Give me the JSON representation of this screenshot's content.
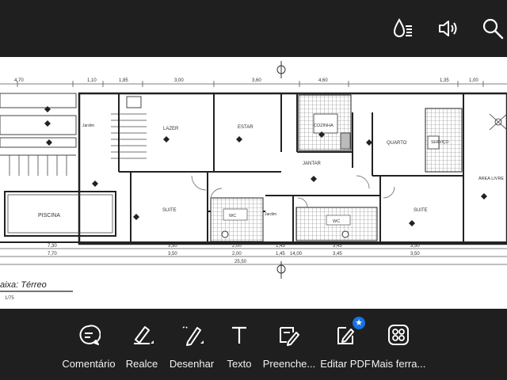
{
  "top_bar": {
    "icons": [
      "read-aloud-icon",
      "speaker-icon",
      "search-icon"
    ]
  },
  "document": {
    "dimensions_top": [
      "4,70",
      "1,10",
      "1,85",
      "3,00",
      "3,60",
      "4,60",
      "1,35",
      "1,00"
    ],
    "dimensions_bottom_1": [
      "7,30",
      "3,50",
      "2,00",
      "1,45",
      "3,45",
      "3,50"
    ],
    "dimensions_bottom_2": [
      "7,70",
      "3,50",
      "2,00",
      "1,45",
      "3,45",
      "3,50"
    ],
    "total_width": "25,50",
    "total_width_2": "14,00",
    "rooms": {
      "lazer": "LAZER",
      "estar": "ESTAR",
      "cozinha": "COZINHA",
      "quarto": "QUARTO",
      "servico": "SERVIÇO",
      "area_livre": "ÁREA LIVRE",
      "jantar": "JANTAR",
      "suite_left": "SUITE",
      "suite_right": "SUITE",
      "wc_left": "WC",
      "wc_right": "WC",
      "piscina": "PISCINA",
      "jardim_left": "Jardim",
      "jardim_center": "Jardim"
    },
    "caption_title": "aixa: Térreo",
    "caption_scale": "1/75"
  },
  "toolbar": {
    "tools": [
      {
        "label": "Comentário",
        "icon": "comment-icon"
      },
      {
        "label": "Realce",
        "icon": "highlight-icon"
      },
      {
        "label": "Desenhar",
        "icon": "draw-icon"
      },
      {
        "label": "Texto",
        "icon": "text-icon"
      },
      {
        "label": "Preenche...",
        "icon": "fill-sign-icon"
      },
      {
        "label": "Editar PDF",
        "icon": "edit-pdf-icon"
      },
      {
        "label": "Mais ferra...",
        "icon": "more-tools-icon"
      }
    ]
  },
  "colors": {
    "bar_background": "#1f1f1f",
    "document_background": "#ffffff",
    "premium_badge": "#1473e6"
  }
}
